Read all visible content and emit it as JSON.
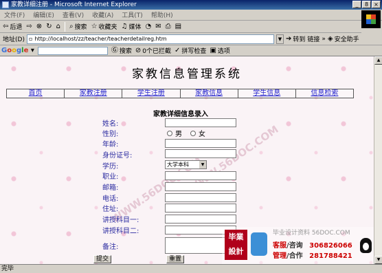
{
  "window": {
    "title": "家教详细注册 - Microsoft Internet Explorer",
    "buttons": [
      "_",
      "8",
      "×"
    ]
  },
  "menubar": [
    "文件(F)",
    "编辑(E)",
    "查看(V)",
    "收藏(A)",
    "工具(T)",
    "帮助(H)"
  ],
  "toolbar": {
    "back": "后退",
    "search": "搜索",
    "favorites": "收藏夹",
    "media": "媒体"
  },
  "addressbar": {
    "label": "地址(D)",
    "url": "http://localhost/zz/teacher/teacherdetailreg.htm",
    "go": "转到",
    "links": "链接",
    "safety": "安全助手"
  },
  "googlebar": {
    "search": "搜索",
    "blocked": "0个已拦截",
    "spell": "拼写检查",
    "options": "选项"
  },
  "page": {
    "title": "家教信息管理系统",
    "nav": [
      "首页",
      "家教注册",
      "学生注册",
      "家教信息",
      "学生信息",
      "信息检索"
    ],
    "form_title": "家教详细信息录入",
    "labels": {
      "name": "姓名:",
      "gender": "性别:",
      "age": "年龄:",
      "id_number": "身份证号:",
      "education": "学历:",
      "occupation": "职业:",
      "email": "邮箱:",
      "phone": "电话:",
      "address": "住址:",
      "subject1": "讲授科目一:",
      "subject2": "讲授科目二:",
      "remarks": "备注:"
    },
    "gender_options": [
      "男",
      "女"
    ],
    "education_value": "大学本科",
    "submit": "提交",
    "reset": "重置",
    "watermark": "WWW.56DOC.COM"
  },
  "ad": {
    "logo_line1": "毕業",
    "logo_line2": "設計",
    "tagline": "毕业设计资料 56DOC.COM",
    "row1_label_red": "客服",
    "row1_label_dark": "/咨询",
    "row1_number": "306826066",
    "row2_label_red": "管理",
    "row2_label_dark": "/合作",
    "row2_number": "281788421"
  },
  "statusbar": "完毕"
}
